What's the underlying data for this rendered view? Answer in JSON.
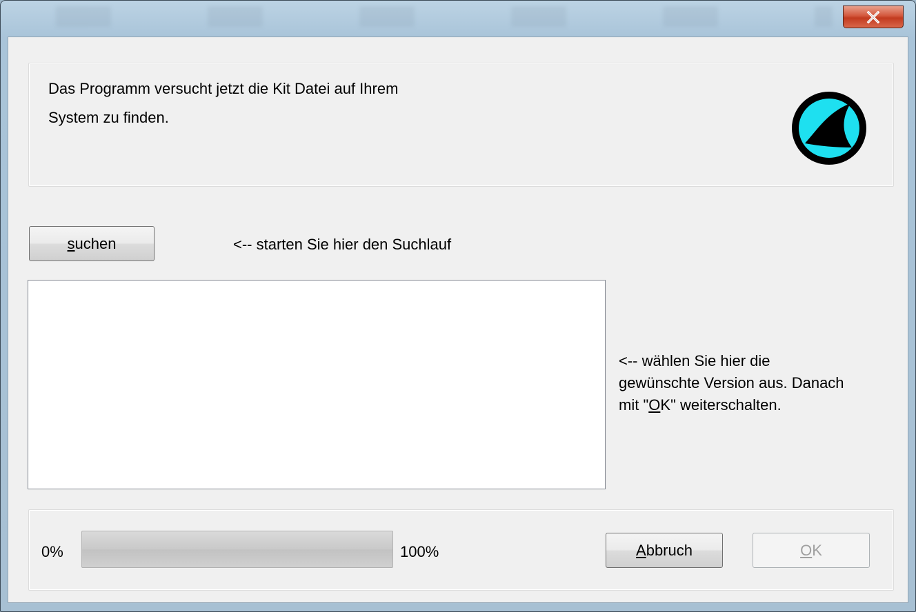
{
  "header": {
    "line1": "Das Programm versucht jetzt die Kit Datei auf Ihrem",
    "line2": "System zu finden."
  },
  "search": {
    "button_prefix": "",
    "button_mnemonic": "s",
    "button_rest": "uchen",
    "hint": "<-- starten Sie hier den Suchlauf"
  },
  "version_list": {
    "items": []
  },
  "version_hint": {
    "line1": "<-- wählen Sie hier die",
    "line2": "gewünschte Version aus. Danach",
    "line3_pre": "mit \"",
    "line3_mnemonic": "O",
    "line3_mid": "K",
    "line3_post": "\" weiterschalten."
  },
  "progress": {
    "min_label": "0%",
    "max_label": "100%",
    "value_fraction": 0
  },
  "buttons": {
    "abbruch_mnemonic": "A",
    "abbruch_rest": "bbruch",
    "ok_mnemonic": "O",
    "ok_rest": "K",
    "ok_enabled": false
  },
  "colors": {
    "logo_ring": "#000000",
    "logo_fill": "#1ee0f0",
    "close_button": "#c8452a"
  },
  "icons": {
    "close": "close-icon",
    "logo": "shark-fin-logo-icon"
  }
}
